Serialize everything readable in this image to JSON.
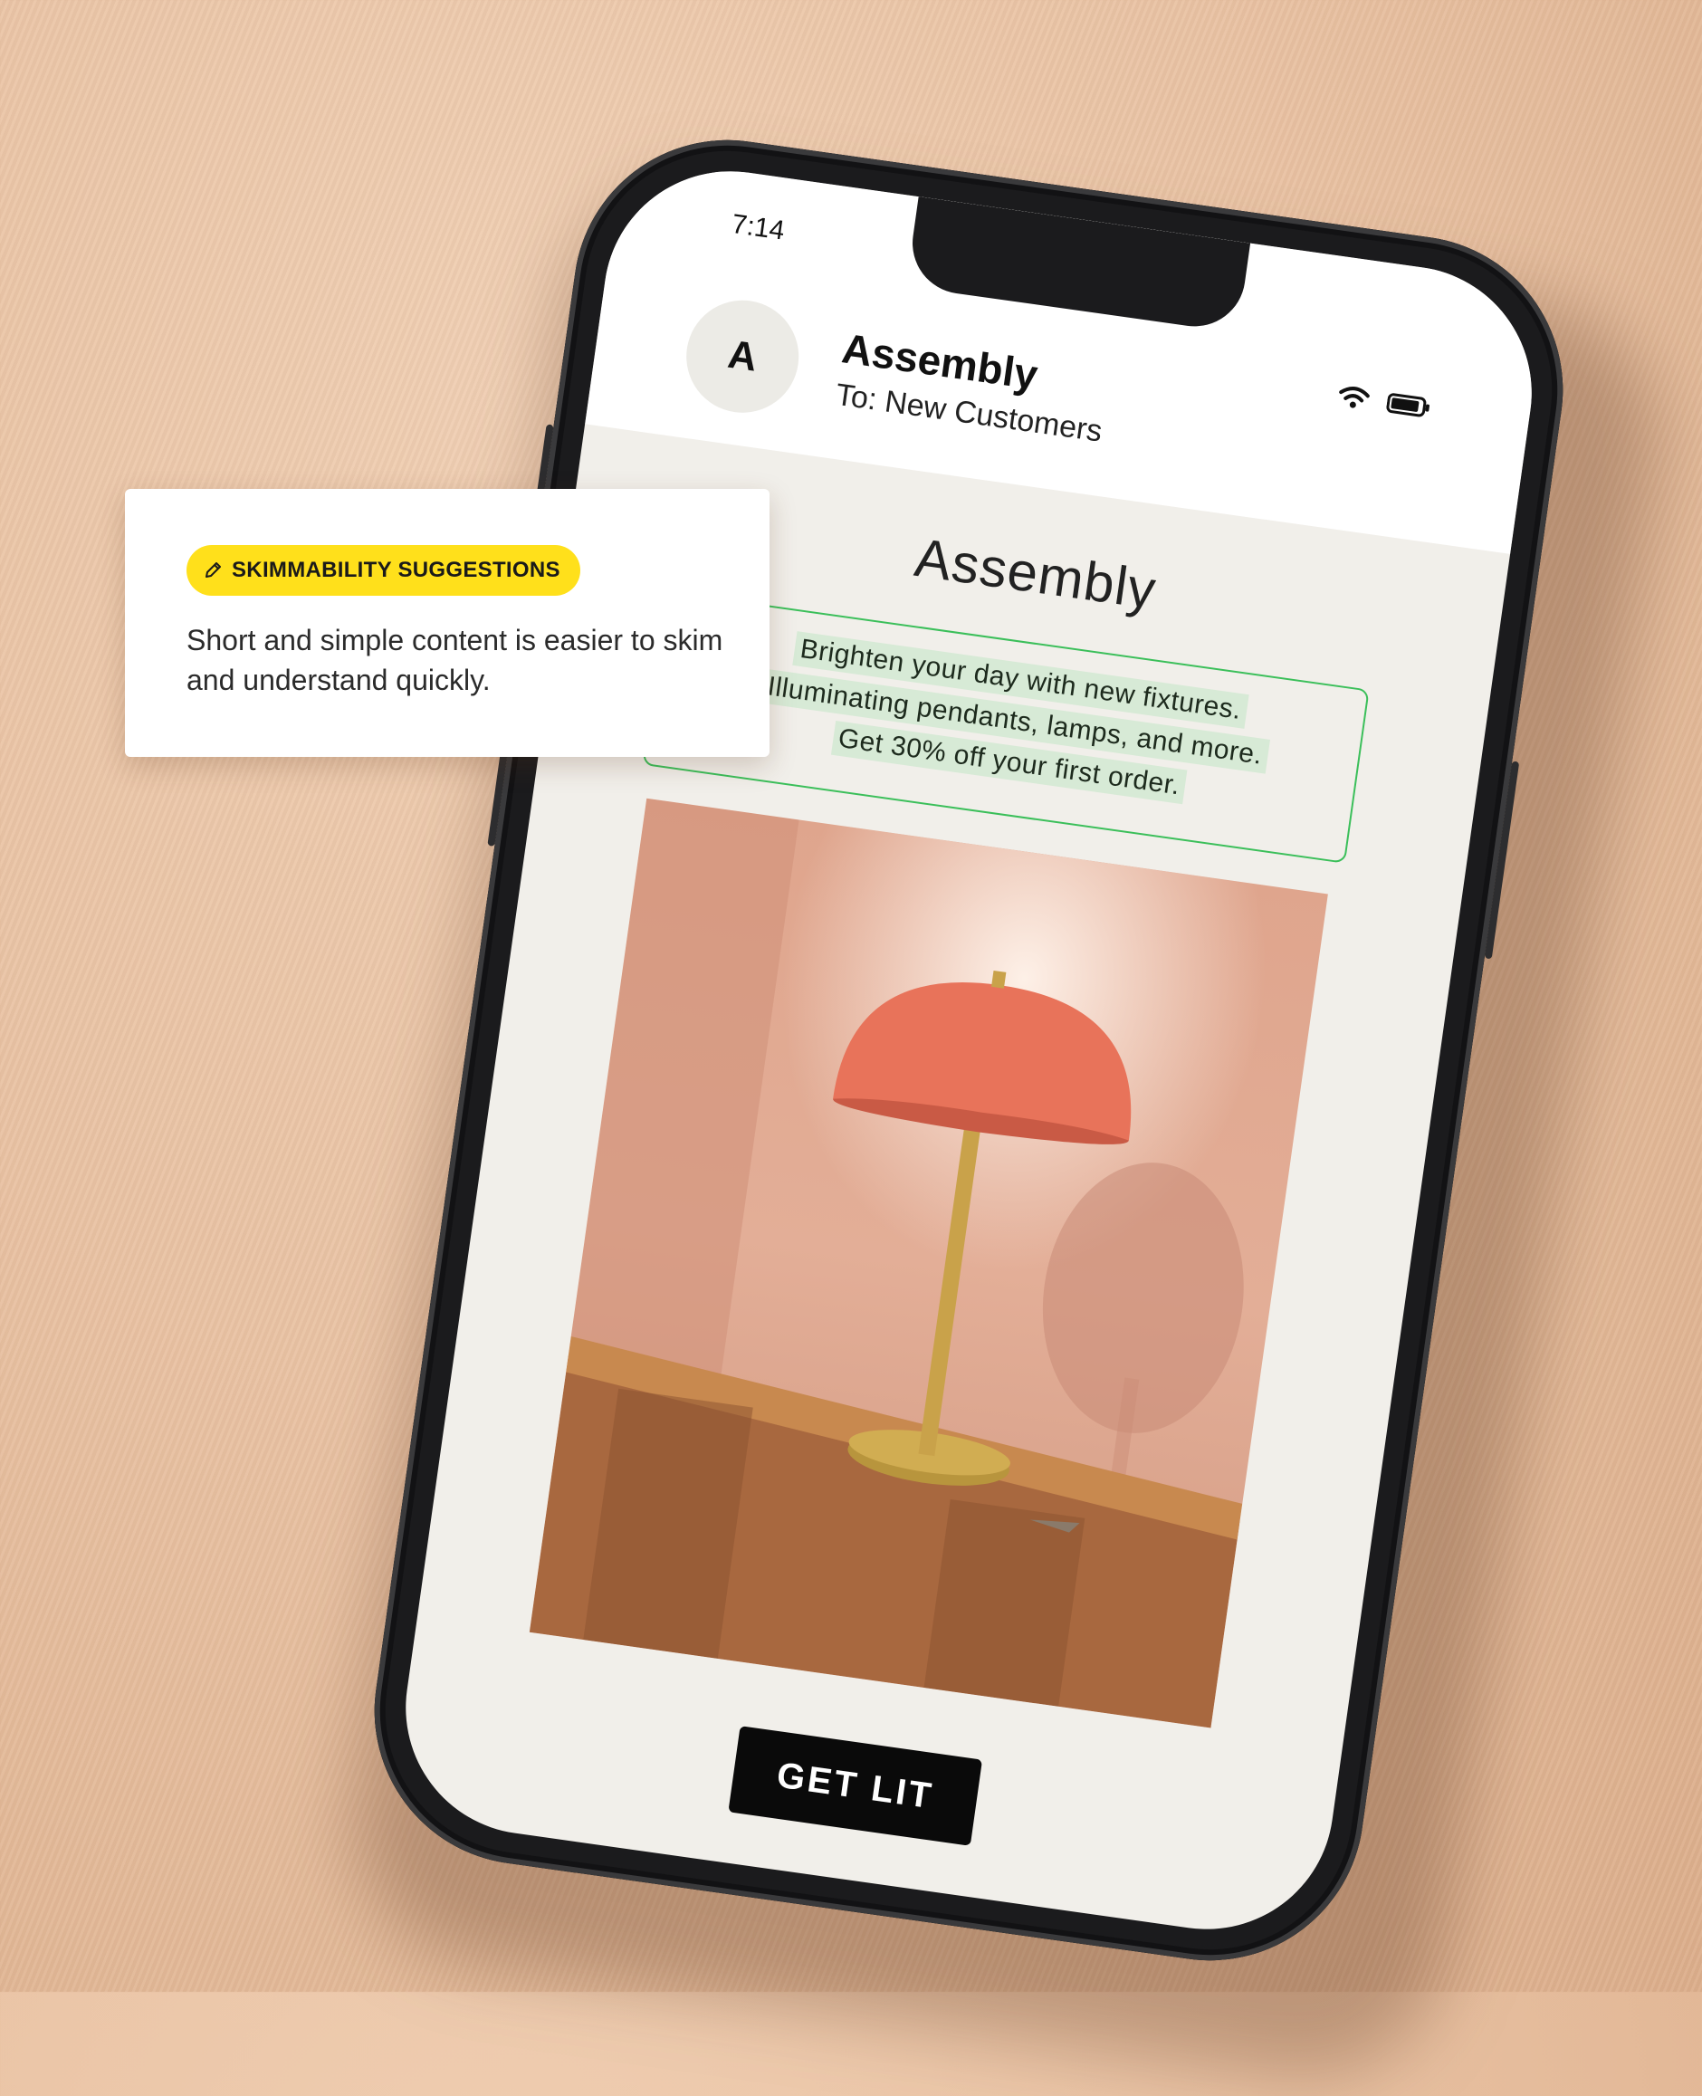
{
  "email": {
    "status_time": "7:14",
    "sender_initial": "A",
    "sender_name": "Assembly",
    "recipients": "To: New Customers",
    "brand_heading": "Assembly",
    "highlighted_copy": [
      "Brighten your day with new fixtures.",
      "Illuminating pendants, lamps, and more.",
      "Get 30% off your first order."
    ],
    "cta_label": "GET LIT"
  },
  "suggestion_card": {
    "badge_label": "SKIMMABILITY SUGGESTIONS",
    "badge_icon": "pencil-icon",
    "message": "Short and simple content is easier to skim and understand quickly."
  },
  "colors": {
    "badge_yellow": "#ffe01b",
    "highlight_border": "#3bbf5a",
    "highlight_fill": "#d7ead6",
    "cta_background": "#0a0a0a",
    "lamp_shade": "#e8735a"
  }
}
